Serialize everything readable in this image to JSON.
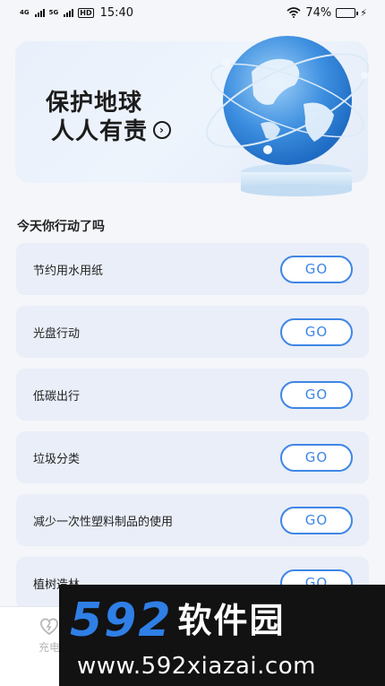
{
  "status_bar": {
    "sig1_label": "4G",
    "sig2_label": "5G",
    "hd_label": "HD",
    "time": "15:40",
    "battery_text": "74%",
    "battery_level": 0.74,
    "icons": [
      "signal-icon",
      "wifi-icon",
      "battery-icon",
      "charging-icon"
    ]
  },
  "banner": {
    "title": "保护地球",
    "subtitle": "人人有责",
    "arrow_icon": "arrow-right-circle-icon",
    "image": "globe-illustration",
    "colors": {
      "globe": "#3d8fe0",
      "pedestal": "#cfe3f6"
    }
  },
  "section_title": "今天你行动了吗",
  "tasks": [
    {
      "label": "节约用水用纸",
      "button": "GO"
    },
    {
      "label": "光盘行动",
      "button": "GO"
    },
    {
      "label": "低碳出行",
      "button": "GO"
    },
    {
      "label": "垃圾分类",
      "button": "GO"
    },
    {
      "label": "减少一次性塑料制品的使用",
      "button": "GO"
    },
    {
      "label": "植树造林",
      "button": "GO"
    }
  ],
  "bottom_nav": {
    "items": [
      {
        "label": "充电",
        "icon": "charge-icon"
      }
    ]
  },
  "watermark": {
    "logo_number": "592",
    "logo_text": "软件园",
    "url": "www.592xiazai.com",
    "colors": {
      "number": "#2f7fe6",
      "background": "#121212"
    }
  },
  "colors": {
    "accent": "#3f86e6",
    "card_bg": "#e9eef8",
    "page_bg": "#f4f6fa"
  }
}
